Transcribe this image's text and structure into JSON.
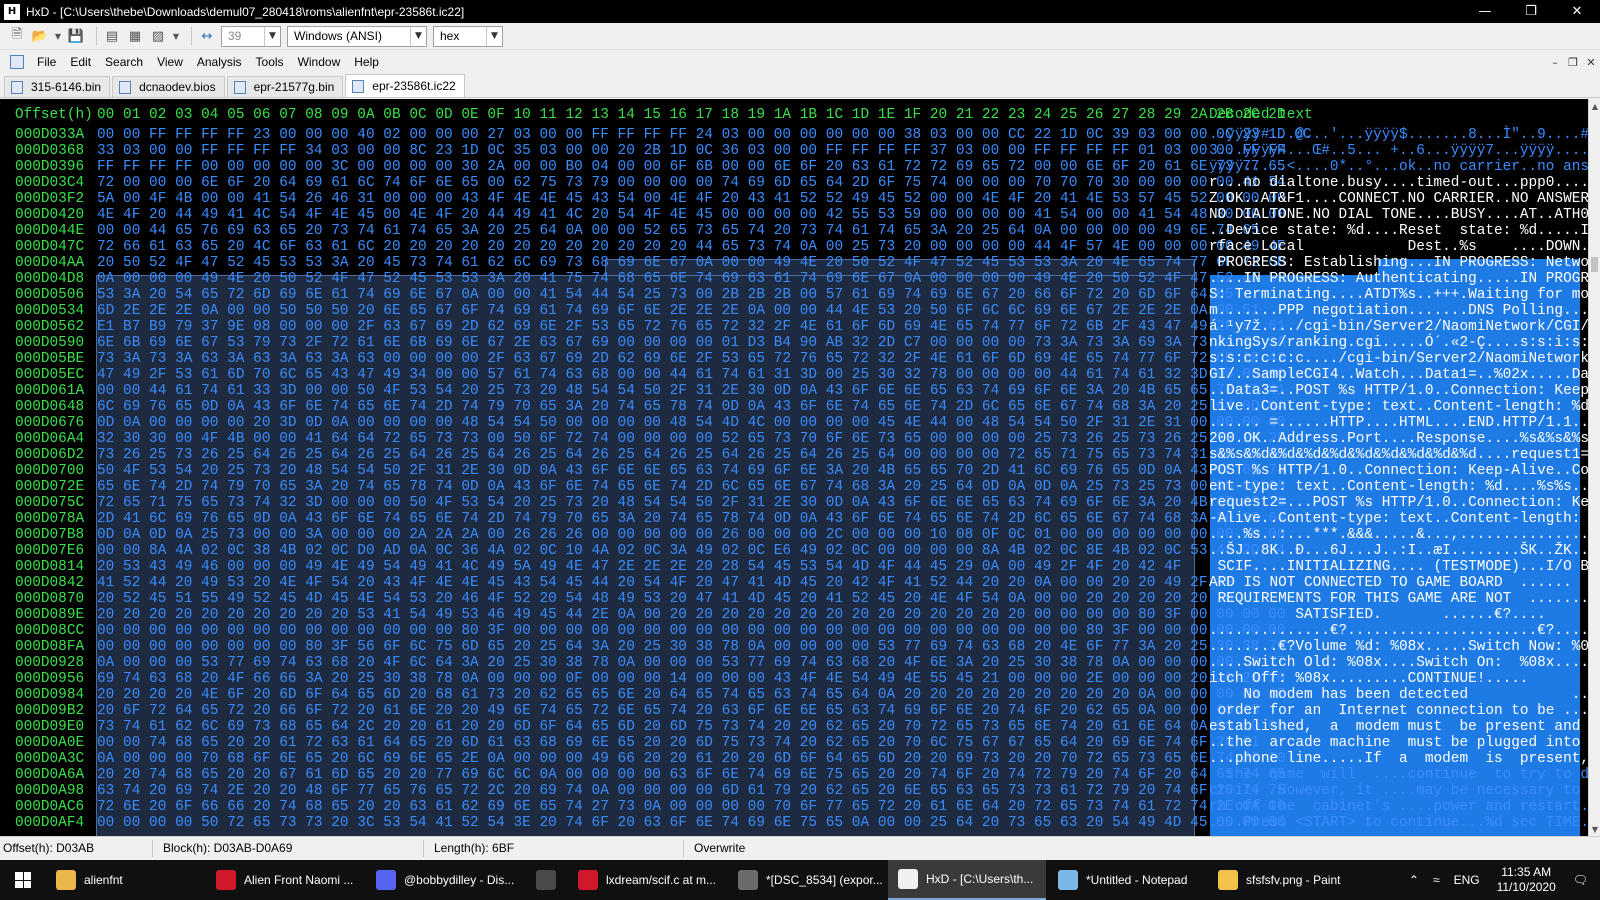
{
  "window": {
    "app_icon": "hxd-icon",
    "title": "HxD - [C:\\Users\\thebe\\Downloads\\demul07_280418\\roms\\alienfnt\\epr-23586t.ic22]",
    "controls": [
      "minimize-icon",
      "maximize-icon",
      "close-icon"
    ]
  },
  "toolbar": {
    "icons": [
      "new-file-icon",
      "open-folder-icon",
      "dropdown-arrow-icon",
      "save-icon",
      "close-file-icon",
      "save-all-icon",
      "save-as-icon",
      "dropdown-arrow-icon",
      "bytes-per-row-icon"
    ],
    "bytes_per_row": "39",
    "charset": "Windows (ANSI)",
    "offset_base": "hex"
  },
  "menu": {
    "items": [
      "File",
      "Edit",
      "Search",
      "View",
      "Analysis",
      "Tools",
      "Window",
      "Help"
    ]
  },
  "tabs": [
    {
      "label": "315-6146.bin",
      "active": false
    },
    {
      "label": "dcnaodev.bios",
      "active": false
    },
    {
      "label": "epr-21577g.bin",
      "active": false
    },
    {
      "label": "epr-23586t.ic22",
      "active": true
    }
  ],
  "hex_view": {
    "header_offset": "Offset(h)",
    "header_columns": "00 01 02 03 04 05 06 07 08 09 0A 0B 0C 0D 0E 0F 10 11 12 13 14 15 16 17 18 19 1A 1B 1C 1D 1E 1F 20 21 22 23 24 25 26 27 28 29 2A 2B 2C 2D",
    "header_decoded": "Decoded text",
    "rows": [
      {
        "offset": "000D033A",
        "bytes": "00 00 FF FF FF FF 23 00 00 00 40 02 00 00 00 27 03 00 00 FF FF FF FF 24 03 00 00 00 00 00 00 38 03 00 00 CC 22 1D 0C 39 03 00 00 0C 23 1D 0C",
        "text": "..ÿÿÿÿ#...@...'...ÿÿÿÿ$.......8...Ì\"..9....#.."
      },
      {
        "offset": "000D0368",
        "bytes": "33 03 00 00 FF FF FF FF 34 03 00 00 8C 23 1D 0C 35 03 00 00 20 2B 1D 0C 36 03 00 00 FF FF FF FF 37 03 00 00 FF FF FF FF 01 03 00 00 FF FF",
        "text": "3...ÿÿÿÿ4...Œ#..5... +..6...ÿÿÿÿ7...ÿÿÿÿ....ÿÿ"
      },
      {
        "offset": "000D0396",
        "bytes": "FF FF FF FF 00 00 00 00 00 3C 00 00 00 00 30 2A 00 00 B0 04 00 00 6F 6B 00 00 6E 6F 20 63 61 72 72 69 65 72 00 00 6E 6F 20 61 6E 73 77 65",
        "text": "ÿÿÿÿ.....<....0*..°...ok..no carrier..no answe"
      },
      {
        "offset": "000D03C4",
        "bytes": "72 00 00 00 6E 6F 20 64 69 61 6C 74 6F 6E 65 00 62 75 73 79 00 00 00 00 74 69 6D 65 64 2D 6F 75 74 00 00 00 70 70 70 30 00 00 00 00 41 54",
        "text": "r...no dialtone.busy....timed-out...ppp0....AT"
      },
      {
        "offset": "000D03F2",
        "bytes": "5A 00 4F 4B 00 00 41 54 26 46 31 00 00 00 43 4F 4E 4E 45 43 54 00 4E 4F 20 43 41 52 52 49 45 52 00 00 4E 4F 20 41 4E 53 57 45 52 00 00 00",
        "text": "Z.OK..AT&F1....CONNECT.NO CARRIER..NO ANSWER..."
      },
      {
        "offset": "000D0420",
        "bytes": "4E 4F 20 44 49 41 4C 54 4F 4E 45 00 4E 4F 20 44 49 41 4C 20 54 4F 4E 45 00 00 00 00 42 55 53 59 00 00 00 00 41 54 00 00 41 54 48 30 00 00",
        "text": "NO DIALTONE.NO DIAL TONE....BUSY....AT..ATH0.."
      },
      {
        "offset": "000D044E",
        "bytes": "00 00 44 65 76 69 63 65 20 73 74 61 74 65 3A 20 25 64 0A 00 00 52 65 73 65 74 20 73 74 61 74 65 3A 20 25 64 0A 00 00 00 00 49 6E 74 65",
        "text": "..Device state: %d....Reset  state: %d.....Inte"
      },
      {
        "offset": "000D047C",
        "bytes": "72 66 61 63 65 20 4C 6F 63 61 6C 20 20 20 20 20 20 20 20 20 20 20 20 44 65 73 74 0A 00 25 73 20 00 00 00 00 44 4F 57 4E 00 00 00 00 49 4E",
        "text": "rface Local            Dest..%s    ....DOWN....IN"
      },
      {
        "offset": "000D04AA",
        "bytes": "20 50 52 4F 47 52 45 53 53 3A 20 45 73 74 61 62 6C 69 73 68 69 6E 67 0A 00 00 49 4E 20 50 52 4F 47 52 45 53 53 3A 20 4E 65 74 77 6F 72 6B",
        "text": " PROGRESS: Establishing...IN PROGRESS: Network"
      },
      {
        "offset": "000D04D8",
        "bytes": "0A 00 00 00 49 4E 20 50 52 4F 47 52 45 53 53 3A 20 41 75 74 68 65 6E 74 69 63 61 74 69 6E 67 0A 00 00 00 00 49 4E 20 50 52 4F 47 52 45 53",
        "text": "....IN PROGRESS: Authenticating.....IN PROGRES"
      },
      {
        "offset": "000D0506",
        "bytes": "53 3A 20 54 65 72 6D 69 6E 61 74 69 6E 67 0A 00 00 41 54 44 54 25 73 00 2B 2B 2B 00 57 61 69 74 69 6E 67 20 66 6F 72 20 6D 6F 64 65",
        "text": "S: Terminating....ATDT%s..+++.Waiting for mode"
      },
      {
        "offset": "000D0534",
        "bytes": "6D 2E 2E 2E 0A 00 00 50 50 50 20 6E 65 67 6F 74 69 61 74 69 6F 6E 2E 2E 2E 0A 00 00 44 4E 53 20 50 6F 6C 6C 69 6E 67 2E 2E 2E 0A 00 51",
        "text": "m.......PPP negotiation.......DNS Polling......Q"
      },
      {
        "offset": "000D0562",
        "bytes": "E1 B7 B9 79 37 9E 08 00 00 00 2F 63 67 69 2D 62 69 6E 2F 53 65 72 76 65 72 32 2F 4E 61 6F 6D 69 4E 65 74 77 6F 72 6B 2F 43 47 49 2F 52 61",
        "text": "á·¹y7ž..../cgi-bin/Server2/NaomiNetwork/CGI/Ra"
      },
      {
        "offset": "000D0590",
        "bytes": "6E 6B 69 6E 67 53 79 73 2F 72 61 6E 6B 69 6E 67 2E 63 67 69 00 00 00 00 01 D3 B4 90 AB 32 2D C7 00 00 00 00 73 3A 73 3A 69 3A 73 3A 73 3A",
        "text": "nkingSys/ranking.cgi.....Ó´.«2-Ç....s:s:i:s:s:"
      },
      {
        "offset": "000D05BE",
        "bytes": "73 3A 73 3A 63 3A 63 3A 63 3A 63 00 00 00 00 2F 63 67 69 2D 62 69 6E 2F 53 65 72 76 65 72 32 2F 4E 61 6F 6D 69 4E 65 74 77 6F 72 6B 2F 43",
        "text": "s:s:c:c:c:c..../cgi-bin/Server2/NaomiNetwork/C"
      },
      {
        "offset": "000D05EC",
        "bytes": "47 49 2F 53 61 6D 70 6C 65 43 47 49 34 00 00 57 61 74 63 68 00 00 44 61 74 61 31 3D 00 25 30 32 78 00 00 00 00 44 61 74 61 32 3D 00 00 00",
        "text": "GI/..SampleCGI4..Watch...Data1=..%02x.....Data2="
      },
      {
        "offset": "000D061A",
        "bytes": "00 00 44 61 74 61 33 3D 00 00 50 4F 53 54 20 25 73 20 48 54 54 50 2F 31 2E 30 0D 0A 43 6F 6E 6E 65 63 74 69 6F 6E 3A 20 4B 65 65 70 2D 41",
        "text": "..Data3=..POST %s HTTP/1.0..Connection: Keep-A"
      },
      {
        "offset": "000D0648",
        "bytes": "6C 69 76 65 0D 0A 43 6F 6E 74 65 6E 74 2D 74 79 70 65 3A 20 74 65 78 74 0D 0A 43 6F 6E 74 65 6E 74 2D 6C 65 6E 67 74 68 3A 20 25 64 0D 0A",
        "text": "live..Content-type: text..Content-length: %d..."
      },
      {
        "offset": "000D0676",
        "bytes": "0D 0A 00 00 00 00 20 3D 0D 0A 00 00 00 00 48 54 54 50 00 00 00 00 48 54 4D 4C 00 00 00 00 45 4E 44 00 48 54 54 50 2F 31 2E 31 00 00 00 00",
        "text": "...... =......HTTP....HTML....END.HTTP/1.1...."
      },
      {
        "offset": "000D06A4",
        "bytes": "32 30 30 00 4F 4B 00 00 41 64 64 72 65 73 73 00 50 6F 72 74 00 00 00 00 52 65 73 70 6F 6E 73 65 00 00 00 00 25 73 26 25 73 26 25 73 26 25",
        "text": "200.OK..Address.Port....Response....%s&%s&%s&%"
      },
      {
        "offset": "000D06D2",
        "bytes": "73 26 25 73 26 25 64 26 25 64 26 25 64 26 25 64 26 25 64 26 25 64 26 25 64 26 25 64 26 25 64 00 00 00 00 72 65 71 75 65 73 74 31 3D 00 00",
        "text": "s&%s&%d&%d&%d&%d&%d&%d&%d&%d&%d....request1=.."
      },
      {
        "offset": "000D0700",
        "bytes": "50 4F 53 54 20 25 73 20 48 54 54 50 2F 31 2E 30 0D 0A 43 6F 6E 6E 65 63 74 69 6F 6E 3A 20 4B 65 65 70 2D 41 6C 69 76 65 0D 0A 43 6F 6E 74",
        "text": "POST %s HTTP/1.0..Connection: Keep-Alive..Cont"
      },
      {
        "offset": "000D072E",
        "bytes": "65 6E 74 2D 74 79 70 65 3A 20 74 65 78 74 0D 0A 43 6F 6E 74 65 6E 74 2D 6C 65 6E 67 74 68 3A 20 25 64 0D 0A 0D 0A 25 73 25 73 00 00 00 00",
        "text": "ent-type: text..Content-length: %d....%s%s...."
      },
      {
        "offset": "000D075C",
        "bytes": "72 65 71 75 65 73 74 32 3D 00 00 00 50 4F 53 54 20 25 73 20 48 54 54 50 2F 31 2E 30 0D 0A 43 6F 6E 6E 65 63 74 69 6F 6E 3A 20 4B 65 65 70",
        "text": "request2=...POST %s HTTP/1.0..Connection: Keep"
      },
      {
        "offset": "000D078A",
        "bytes": "2D 41 6C 69 76 65 0D 0A 43 6F 6E 74 65 6E 74 2D 74 79 70 65 3A 20 74 65 78 74 0D 0A 43 6F 6E 74 65 6E 74 2D 6C 65 6E 67 74 68 3A 20 25 64",
        "text": "-Alive..Content-type: text..Content-length: %d"
      },
      {
        "offset": "000D07B8",
        "bytes": "0D 0A 0D 0A 25 73 00 00 3A 00 00 00 2A 2A 2A 00 26 26 26 00 00 00 00 00 26 00 00 00 2C 00 00 00 10 08 0F 0C 01 00 00 00 00 00 00 00 00 00",
        "text": "....%s..:...***.&&&.....&...,.................."
      },
      {
        "offset": "000D07E6",
        "bytes": "00 00 8A 4A 02 0C 38 4B 02 0C D0 AD 0A 0C 36 4A 02 0C 10 4A 02 0C 3A 49 02 0C E6 49 02 0C 00 00 00 00 8A 4B 02 0C 8E 4B 02 0C 53 48 2D 34",
        "text": "..ŠJ..8K..Ð...6J...J..:I..æI........ŠK..ŽK..SH-4"
      },
      {
        "offset": "000D0814",
        "bytes": "20 53 43 49 46 00 00 00 49 4E 49 54 49 41 4C 49 5A 49 4E 47 2E 2E 2E 20 28 54 45 53 54 4D 4F 44 45 29 0A 00 49 2F 4F 20 42 4F",
        "text": " SCIF....INITIALIZING.... (TESTMODE)...I/O BO"
      },
      {
        "offset": "000D0842",
        "bytes": "41 52 44 20 49 53 20 4E 4F 54 20 43 4F 4E 4E 45 43 54 45 44 20 54 4F 20 47 41 4D 45 20 42 4F 41 52 44 20 20 0A 00 00 20 20 49 2F 4F",
        "text": "ARD IS NOT CONNECTED TO GAME BOARD  ......  I/O"
      },
      {
        "offset": "000D0870",
        "bytes": "20 52 45 51 55 49 52 45 4D 45 4E 54 53 20 46 4F 52 20 54 48 49 53 20 47 41 4D 45 20 41 52 45 20 4E 4F 54 0A 00 00 20 20 20 20 20 20",
        "text": " REQUIREMENTS FOR THIS GAME ARE NOT  ......."
      },
      {
        "offset": "000D089E",
        "bytes": "20 20 20 20 20 20 20 20 20 20 53 41 54 49 53 46 49 45 44 2E 0A 00 20 20 20 20 20 20 20 20 20 20 20 20 20 20 00 00 00 00 80 3F 00 00 00 00",
        "text": "          SATISFIED.       ......€?...."
      },
      {
        "offset": "000D08CC",
        "bytes": "00 00 00 00 00 00 00 00 00 00 00 00 00 00 80 3F 00 00 00 00 00 00 00 00 00 00 00 00 00 00 00 00 00 00 00 00 00 00 80 3F 00 00 00 00 00 00",
        "text": "..............€?......................€?......"
      },
      {
        "offset": "000D08FA",
        "bytes": "00 00 00 00 00 00 00 00 80 3F 56 6F 6C 75 6D 65 20 25 64 3A 20 25 30 38 78 0A 00 00 00 00 53 77 69 74 63 68 20 4E 6F 77 3A 20 25 30 38 78",
        "text": "........€?Volume %d: %08x.....Switch Now: %08x"
      },
      {
        "offset": "000D0928",
        "bytes": "0A 00 00 00 53 77 69 74 63 68 20 4F 6C 64 3A 20 25 30 38 78 0A 00 00 00 53 77 69 74 63 68 20 4F 6E 3A 20 25 30 38 78 0A 00 00 00 00 53 77",
        "text": "....Switch Old: %08x....Switch On:  %08x.....Sw"
      },
      {
        "offset": "000D0956",
        "bytes": "69 74 63 68 20 4F 66 66 3A 20 25 30 38 78 0A 00 00 00 0F 00 00 00 14 00 00 00 43 4F 4E 54 49 4E 55 45 21 00 00 00 2E 00 00 00 20 20 20 20",
        "text": "itch Off: %08x.........CONTINUE!....."
      },
      {
        "offset": "000D0984",
        "bytes": "20 20 20 20 4E 6F 20 6D 6F 64 65 6D 20 68 61 73 20 62 65 65 6E 20 64 65 74 65 63 74 65 64 0A 20 20 20 20 20 20 20 20 20 0A 00 00 00 49 6E",
        "text": "    No modem has been detected            ....In"
      },
      {
        "offset": "000D09B2",
        "bytes": "20 6F 72 64 65 72 20 66 6F 72 20 61 6E 20 20 49 6E 74 65 72 6E 65 74 20 63 6F 6E 6E 65 63 74 69 6F 6E 20 74 6F 20 62 65 0A 00 00 00 65",
        "text": " order for an  Internet connection to be ...."
      },
      {
        "offset": "000D09E0",
        "bytes": "73 74 61 62 6C 69 73 68 65 64 2C 20 20 61 20 20 6D 6F 64 65 6D 20 6D 75 73 74 20 20 62 65 20 70 72 65 73 65 6E 74 20 61 6E 64 0A 00 00 00",
        "text": "established,  a  modem must  be present and ..."
      },
      {
        "offset": "000D0A0E",
        "bytes": "00 00 74 68 65 20 20 61 72 63 61 64 65 20 6D 61 63 68 69 6E 65 20 20 6D 75 73 74 20 62 65 20 70 6C 75 67 67 65 64 20 69 6E 74 6F 20 61",
        "text": "..the  arcade machine  must be plugged into a"
      },
      {
        "offset": "000D0A3C",
        "bytes": "0A 00 00 00 70 68 6F 6E 65 20 6C 69 6E 65 2E 0A 00 00 00 49 66 20 20 61 20 20 6D 6F 64 65 6D 20 20 69 73 20 20 70 72 65 73 65 6E 74 2C 20",
        "text": "...phone line.....If  a  modem  is  present,"
      },
      {
        "offset": "000D0A6A",
        "bytes": "20 20 74 68 65 20 20 67 61 6D 65 20 20 77 69 6C 6C 0A 00 00 00 00 63 6F 6E 74 69 6E 75 65 20 20 74 6F 20 74 72 79 20 74 6F 20 64 65 74 65",
        "text": "  the  game  will  ....continue  to try to dete"
      },
      {
        "offset": "000D0A98",
        "bytes": "63 74 20 69 74 2E 20 20 48 6F 77 65 76 65 72 2C 20 69 74 0A 00 00 00 00 6D 61 79 20 62 65 20 6E 65 63 65 73 73 61 72 79 20 74 6F 20 74 75",
        "text": "ct it.  However, it ....may be necessary to tu"
      },
      {
        "offset": "000D0AC6",
        "bytes": "72 6E 20 6F 66 66 20 74 68 65 20 20 63 61 62 69 6E 65 74 27 73 0A 00 00 00 00 70 6F 77 65 72 20 61 6E 64 20 72 65 73 74 61 72 74 2E 0A 00",
        "text": "rn off the  cabinet's ....power and restart.."
      },
      {
        "offset": "000D0AF4",
        "bytes": "00 00 00 00 50 72 65 73 73 20 3C 53 54 41 52 54 3E 20 74 6F 20 63 6F 6E 74 69 6E 75 65 0A 00 00 25 64 20 73 65 63 20 54 49 4D 45 00 00 00",
        "text": "....Press <START> to continue...%d sec TIME..."
      }
    ]
  },
  "scrollbar": {
    "up_icon": "scroll-up-icon",
    "down_icon": "scroll-down-icon"
  },
  "status": {
    "offset": "Offset(h): D03AB",
    "block": "Block(h): D03AB-D0A69",
    "length": "Length(h): 6BF",
    "mode": "Overwrite"
  },
  "taskbar": {
    "start_icon": "windows-start-icon",
    "items": [
      {
        "label": "alienfnt",
        "icon": "folder-icon",
        "color": "#e8b64a",
        "active": false
      },
      {
        "label": "Alien Front Naomi ...",
        "icon": "opera-icon",
        "color": "#d0192b",
        "active": false
      },
      {
        "label": "@bobbydilley - Dis...",
        "icon": "discord-icon",
        "color": "#5865f2",
        "active": false
      },
      {
        "label": "",
        "icon": "visual-studio-code-icon",
        "color": "#4a4a4a",
        "active": false
      },
      {
        "label": "lxdream/scif.c at m...",
        "icon": "opera-icon",
        "color": "#d0192b",
        "active": false
      },
      {
        "label": "*[DSC_8534] (expor...",
        "icon": "image-editor-icon",
        "color": "#6b6b6b",
        "active": false
      },
      {
        "label": "HxD - [C:\\Users\\th...",
        "icon": "hxd-icon",
        "color": "#f0f0f0",
        "active": true
      },
      {
        "label": "*Untitled - Notepad",
        "icon": "notepad-icon",
        "color": "#7bb7e6",
        "active": false
      },
      {
        "label": "sfsfsfv.png - Paint",
        "icon": "paint-icon",
        "color": "#f2c24a",
        "active": false
      }
    ],
    "tray": {
      "icons": [
        "chevron-up-icon",
        "network-icon"
      ],
      "language": "ENG",
      "time": "11:35 AM",
      "date": "11/10/2020",
      "notification_icon": "notification-icon"
    }
  },
  "colors": {
    "offset_green": "#39e04a",
    "hex_blue": "#3a8cff",
    "selection_blue": "#1e7be6",
    "marker_magenta": "#d020d0"
  }
}
